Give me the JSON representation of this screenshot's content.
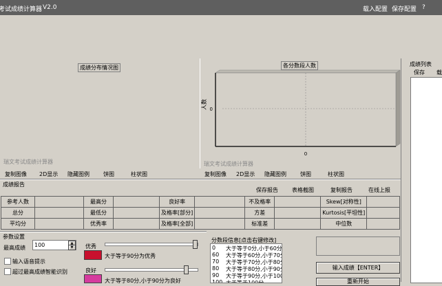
{
  "window": {
    "title": "考试成绩计算器",
    "version": "V2.0",
    "load_config": "载入配置",
    "save_config": "保存配置",
    "help": "?"
  },
  "chart_data": [
    {
      "type": "bar",
      "title": "成绩分布情况图",
      "categories": [],
      "values": [],
      "watermark": "瑞文考试成绩计算器"
    },
    {
      "type": "bar",
      "title": "各分数段人数",
      "ylabel": "人数",
      "categories": [
        "0"
      ],
      "values": [
        0
      ],
      "yticks": [
        "0"
      ],
      "watermark": "瑞文考试成绩计算器"
    }
  ],
  "chart_toolbar_left": [
    "复制图像",
    "2D显示",
    "隐藏图例",
    "饼图",
    "柱状图"
  ],
  "chart_toolbar_right": [
    "复制图像",
    "2D显示",
    "隐藏图例",
    "饼图",
    "柱状图"
  ],
  "report": {
    "title": "成绩报告",
    "actions": [
      "保存报告",
      "表格截图",
      "复制报告",
      "在线上报"
    ],
    "rows": [
      [
        "参考人数",
        "",
        "最高分",
        "",
        "良好率",
        "",
        "不及格率",
        "",
        "Skew[对称性]",
        ""
      ],
      [
        "总分",
        "",
        "最低分",
        "",
        "及格率[部分]",
        "",
        "方差",
        "",
        "Kurtosis[平坦性]",
        ""
      ],
      [
        "平均分",
        "",
        "优秀率",
        "",
        "及格率[全部]",
        "",
        "标准差",
        "",
        "中位数",
        ""
      ]
    ]
  },
  "settings": {
    "title": "参数设置",
    "max_score_label": "最高成绩",
    "max_score_value": "100",
    "voice_prompt": "输入语音提示",
    "smart_detect": "超过最高成绩智能识别",
    "grade1_label": "优秀",
    "grade1_color": "#c8102e",
    "grade1_desc": "大于等于90分为优秀",
    "grade1_level": 0.98,
    "grade2_label": "良好",
    "grade2_color": "#d63b9e",
    "grade2_desc": "大于等于80分,小于90分为良好",
    "grade2_level": 0.88
  },
  "segments": {
    "title": "分数段信息[点击右键修改]",
    "rows": [
      {
        "num": "0",
        "text": "大于等于0分,小于60分"
      },
      {
        "num": "60",
        "text": "大于等于60分,小于70分"
      },
      {
        "num": "70",
        "text": "大于等于70分,小于80分"
      },
      {
        "num": "80",
        "text": "大于等于80分,小于90分"
      },
      {
        "num": "90",
        "text": "大于等于90分,小于100分"
      },
      {
        "num": "100",
        "text": "大于等于100分"
      }
    ]
  },
  "input_button": "输入成绩【ENTER】",
  "second_button": "重新开始",
  "score_list": {
    "title": "成绩列表",
    "save": "保存",
    "load": "载入"
  }
}
